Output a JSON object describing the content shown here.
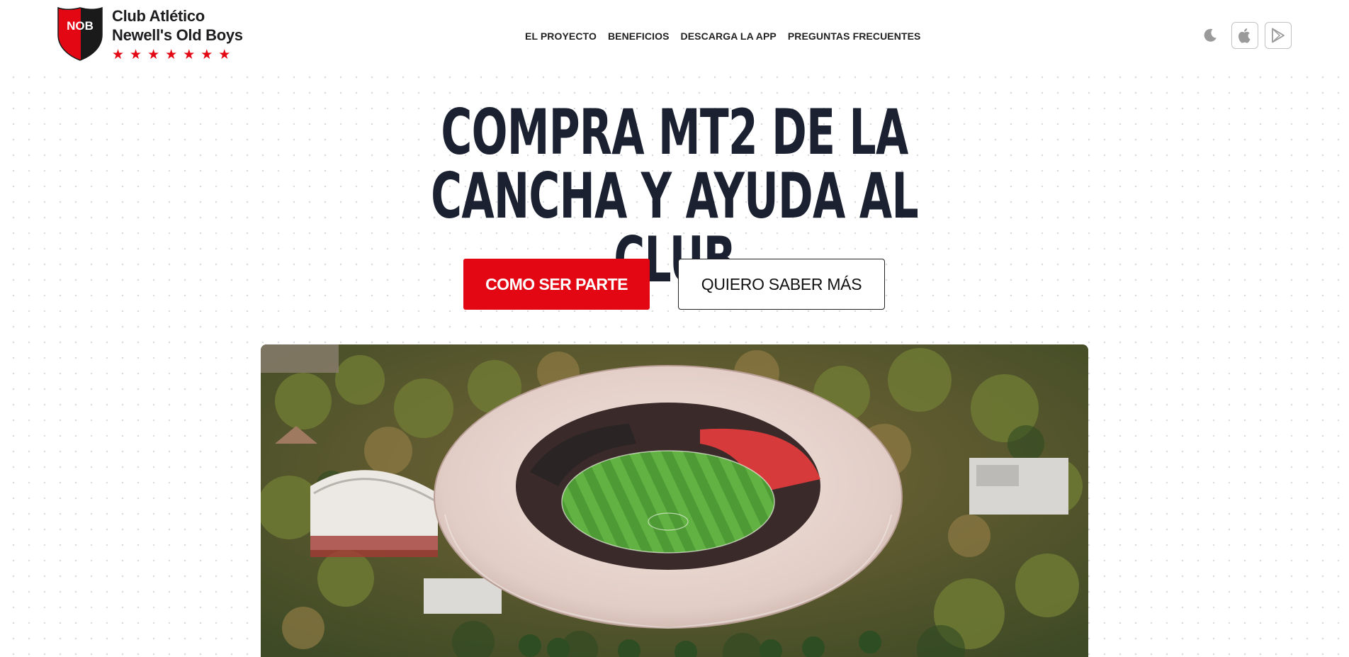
{
  "brand": {
    "shield_text": "NOB",
    "name_line1": "Club Atlético",
    "name_line2": "Newell's Old Boys",
    "stars": [
      "★",
      "★",
      "★",
      "★",
      "★",
      "★",
      "★"
    ],
    "star_color": "#e30613",
    "shield_colors": [
      "#e30613",
      "#1a1a1a"
    ]
  },
  "nav": {
    "items": [
      "EL PROYECTO",
      "BENEFICIOS",
      "DESCARGA LA APP",
      "PREGUNTAS FRECUENTES"
    ]
  },
  "header_icons": {
    "theme_toggle": "moon-icon",
    "app_store": "apple-icon",
    "play_store": "google-play-icon"
  },
  "hero": {
    "title": "COMPRA MT2 DE LA CANCHA Y AYUDA AL CLUB",
    "primary_cta": "COMO SER PARTE",
    "secondary_cta": "QUIERO SABER MÁS",
    "image": "aerial-stadium-render"
  },
  "colors": {
    "accent": "#e30613",
    "title": "#1b2130",
    "text": "#222222"
  }
}
